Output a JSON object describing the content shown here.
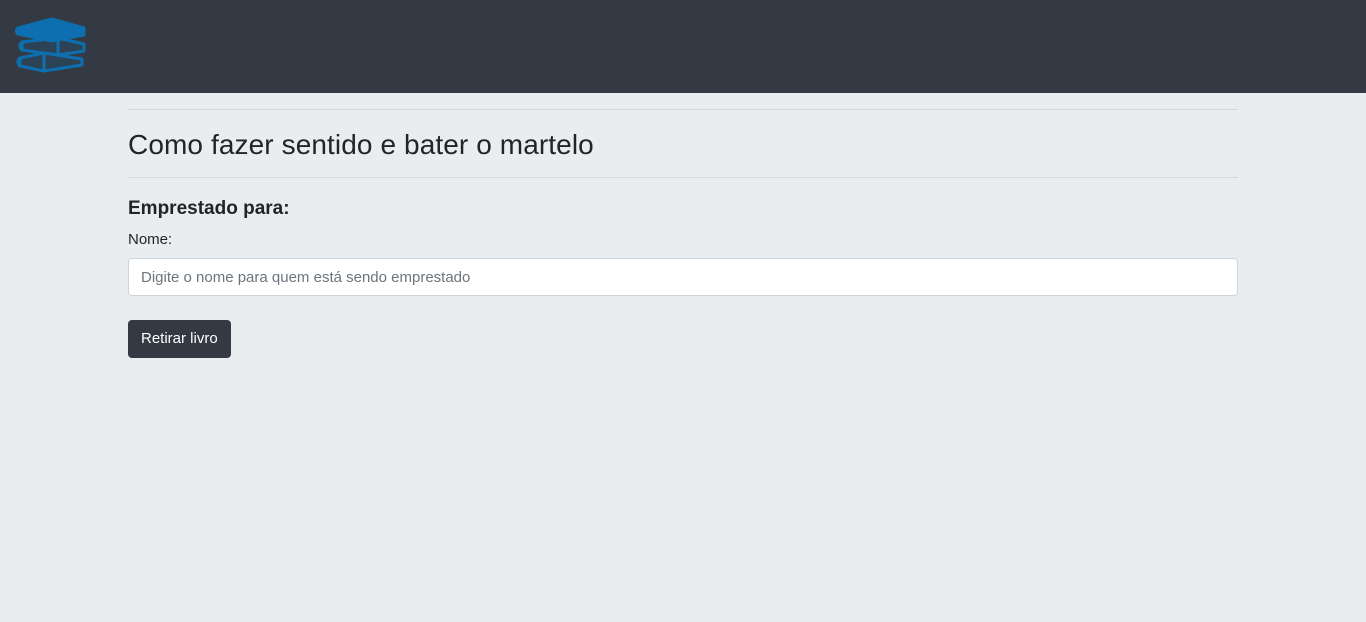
{
  "navbar": {
    "logo_icon": "books-stack-icon",
    "logo_color": "#0d6fb0",
    "background": "#343a43"
  },
  "book": {
    "title": "Como fazer sentido e bater o martelo"
  },
  "loan_form": {
    "heading": "Emprestado para:",
    "name_label": "Nome:",
    "name_placeholder": "Digite o nome para quem está sendo emprestado",
    "name_value": "",
    "submit_label": "Retirar livro"
  }
}
